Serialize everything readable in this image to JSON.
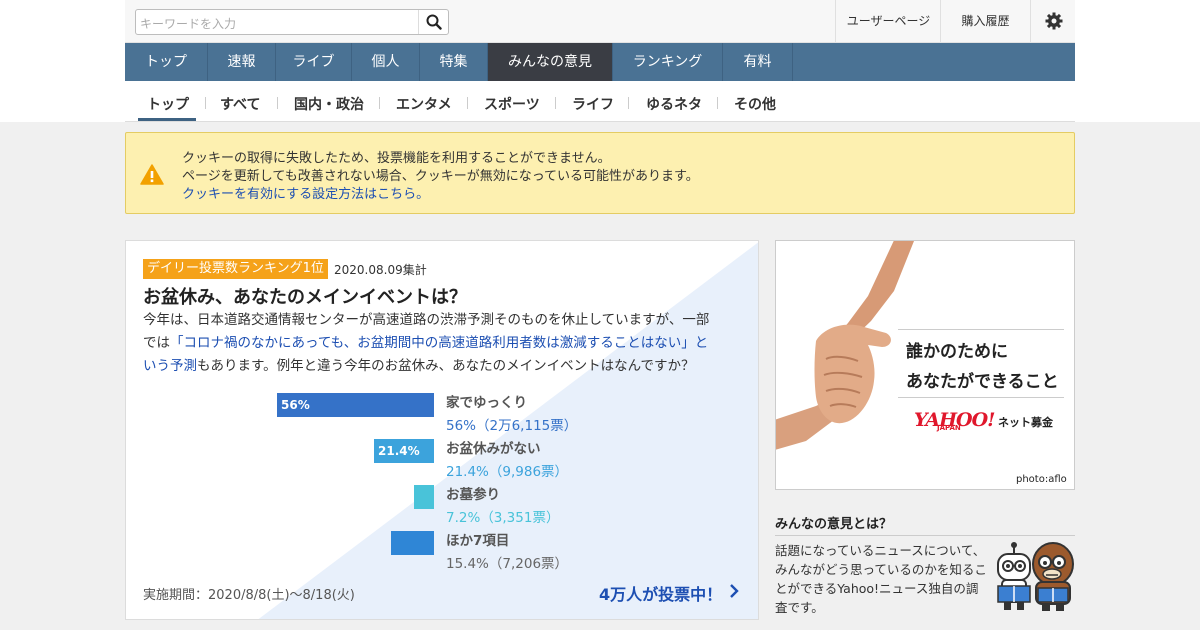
{
  "header": {
    "search_placeholder": "キーワードを入力",
    "user_page_label": "ユーザーページ",
    "purchase_history_label": "購入履歴"
  },
  "nav": {
    "items": [
      {
        "label": "トップ",
        "active": false
      },
      {
        "label": "速報",
        "active": false
      },
      {
        "label": "ライブ",
        "active": false
      },
      {
        "label": "個人",
        "active": false
      },
      {
        "label": "特集",
        "active": false
      },
      {
        "label": "みんなの意見",
        "active": true
      },
      {
        "label": "ランキング",
        "active": false
      },
      {
        "label": "有料",
        "active": false
      }
    ]
  },
  "subnav": {
    "items": [
      "トップ",
      "すべて",
      "国内・政治",
      "エンタメ",
      "スポーツ",
      "ライフ",
      "ゆるネタ",
      "その他"
    ],
    "active": "トップ"
  },
  "alert": {
    "line1": "クッキーの取得に失敗したため、投票機能を利用することができません。",
    "line2": "ページを更新しても改善されない場合、クッキーが無効になっている可能性があります。",
    "link": "クッキーを有効にする設定方法はこちら。"
  },
  "poll": {
    "badge": "デイリー投票数ランキング1位",
    "badge_date": "2020.08.09集計",
    "title": "お盆休み、あなたのメインイベントは？",
    "desc_line1": "今年は、日本道路交通情報センターが高速道路の渋滞予測そのものを休止していますが、一部",
    "desc_line2_pre": "では",
    "desc_link": "「コロナ禍のなかにあっても、お盆期間中の高速道路利用者数は激減することはない」という予測",
    "desc_link_part1": "「コロナ禍のなかにあっても、お盆期間中の高速道路利用者数は激減することはない」と",
    "desc_link_part2": "いう予測",
    "desc_line3_post": "もあります。例年と違う今年のお盆休み、あなたのメインイベントはなんですか？",
    "options": [
      {
        "name": "家でゆっくり",
        "stat": "56%（2万6,115票）",
        "bar_label": "56%",
        "percent": 56,
        "color": "#3572c8"
      },
      {
        "name": "お盆休みがない",
        "stat": "21.4%（9,986票）",
        "bar_label": "21.4%",
        "percent": 21.4,
        "color": "#3ca3dc"
      },
      {
        "name": "お墓参り",
        "stat": "7.2%（3,351票）",
        "bar_label": "",
        "percent": 7.2,
        "color": "#49c3d9"
      },
      {
        "name": "ほか7項目",
        "stat": "15.4%（7,206票）",
        "bar_label": "",
        "percent": 15.4,
        "color": "#2f86d6"
      }
    ],
    "period": "実施期間：2020/8/8(土)〜8/18(火)",
    "cta": "4万人が投票中！"
  },
  "ad": {
    "line1": "誰かのために",
    "line2": "あなたができること",
    "logo": "YAHOO!",
    "logo_sub": "JAPAN",
    "kikin": "ネット募金",
    "credit": "photo:aflo"
  },
  "about": {
    "title": "みんなの意見とは？",
    "text": "話題になっているニュースについて、みんながどう思っているのかを知ることができるYahoo!ニュース独自の調査です。"
  }
}
